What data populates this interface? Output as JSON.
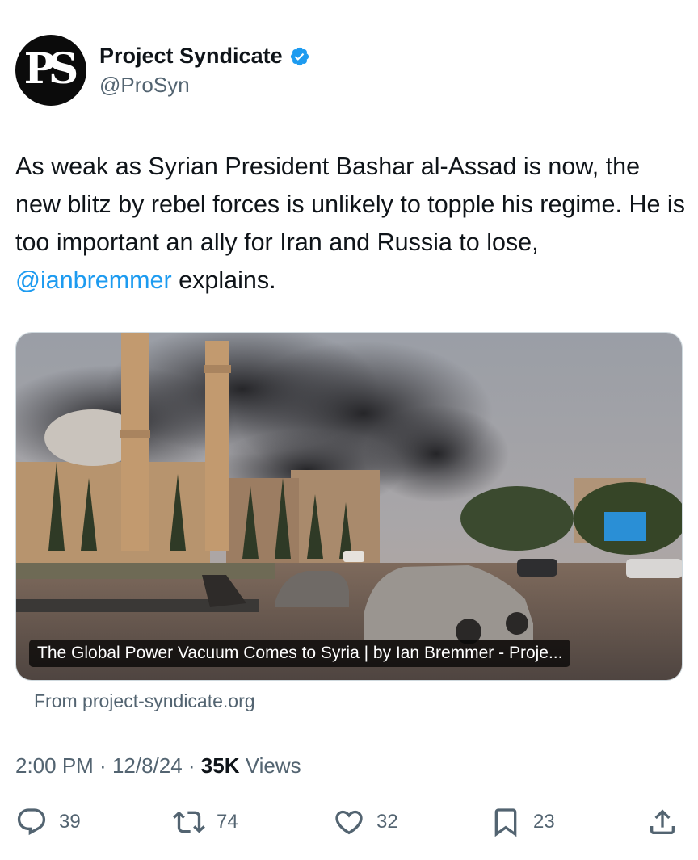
{
  "author": {
    "avatar_text": "PS",
    "display_name": "Project Syndicate",
    "handle": "@ProSyn",
    "verified": true
  },
  "tweet": {
    "text_before": "As weak as Syrian President Bashar al-Assad is now, the new blitz by rebel forces is unlikely to topple his regime. He is too important an ally for Iran and Russia to lose, ",
    "mention": "@ianbremmer",
    "text_after": " explains."
  },
  "card": {
    "title": "The Global Power Vacuum Comes to Syria | by Ian Bremmer - Proje...",
    "domain": "From project-syndicate.org"
  },
  "meta": {
    "time": "2:00 PM",
    "sep1": " · ",
    "date": "12/8/24",
    "sep2": " · ",
    "views_count": "35K",
    "views_label": " Views"
  },
  "actions": {
    "replies": "39",
    "retweets": "74",
    "likes": "32",
    "bookmarks": "23"
  },
  "colors": {
    "accent": "#1d9bf0",
    "secondary_text": "#536471",
    "primary_text": "#0f1419"
  }
}
